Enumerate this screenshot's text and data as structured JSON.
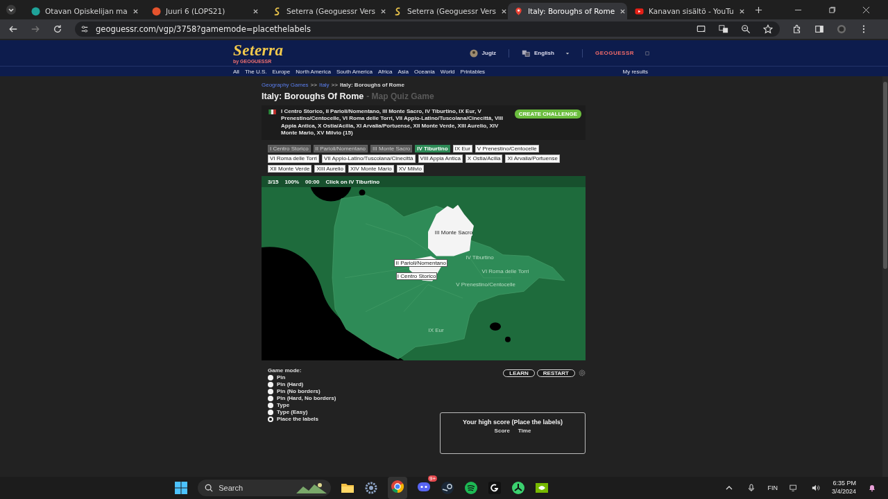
{
  "browser": {
    "tabs": [
      {
        "title": "Otavan Opiskelijan ma",
        "selected": false
      },
      {
        "title": "Juuri 6 (LOPS21)",
        "selected": false
      },
      {
        "title": "Seterra (Geoguessr Vers",
        "selected": false
      },
      {
        "title": "Seterra (Geoguessr Vers",
        "selected": false
      },
      {
        "title": "Italy: Boroughs of Rome",
        "selected": true
      },
      {
        "title": "Kanavan sisältö - YouTu",
        "selected": false
      }
    ],
    "address": "geoguessr.com/vgp/3758?gamemode=placethelabels"
  },
  "site": {
    "logo": "Seterra",
    "logo_byline": "by GEOGUESSR",
    "user": "Jugiz",
    "language": "English",
    "brand_link": "GEOGUESSR",
    "nav": [
      "All",
      "The U.S.",
      "Europe",
      "North America",
      "South America",
      "Africa",
      "Asia",
      "Oceania",
      "World",
      "Printables"
    ],
    "my_results": "My results"
  },
  "breadcrumb": {
    "links": [
      "Geography Games",
      "Italy"
    ],
    "separator": ">>",
    "current": "Italy: Boroughs of Rome"
  },
  "title": "Italy: Boroughs Of Rome",
  "subtitle": "- Map Quiz Game",
  "description": "I Centro Storico, II Parioli/Nomentano, III Monte Sacro, IV Tiburtino, IX Eur, V Prenestino/Centocelle, VI Roma delle Torri, VII Appio-Latino/Tuscolana/Cinecittà, VIII Appia Antica, X Ostia/Acilia, XI Arvalia/Portuense, XII Monte Verde, XIII Aurelio, XIV Monte Mario, XV Milvio (15)",
  "challenge_button": "CREATE CHALLENGE",
  "labels": [
    {
      "text": "I Centro Storico",
      "placed": true,
      "selected": false
    },
    {
      "text": "II Parioli/Nomentano",
      "placed": true,
      "selected": false
    },
    {
      "text": "III Monte Sacro",
      "placed": true,
      "selected": false
    },
    {
      "text": "IV Tiburtino",
      "placed": false,
      "selected": true
    },
    {
      "text": "IX Eur",
      "placed": false,
      "selected": false
    },
    {
      "text": "V Prenestino/Centocelle",
      "placed": false,
      "selected": false
    },
    {
      "text": "VI Roma delle Torri",
      "placed": false,
      "selected": false
    },
    {
      "text": "VII Appio-Latino/Tuscolana/Cinecittà",
      "placed": false,
      "selected": false
    },
    {
      "text": "VIII Appia Antica",
      "placed": false,
      "selected": false
    },
    {
      "text": "X Ostia/Acilia",
      "placed": false,
      "selected": false
    },
    {
      "text": "XI Arvalia/Portuense",
      "placed": false,
      "selected": false
    },
    {
      "text": "XII Monte Verde",
      "placed": false,
      "selected": false
    },
    {
      "text": "XIII Aurelio",
      "placed": false,
      "selected": false
    },
    {
      "text": "XIV Monte Mario",
      "placed": false,
      "selected": false
    },
    {
      "text": "XV Milvio",
      "placed": false,
      "selected": false
    }
  ],
  "map": {
    "counter": "3/15",
    "score": "100%",
    "timer": "00:00",
    "prompt": "Click on IV Tiburtino",
    "map_labels": [
      {
        "text": "III Monte Sacro",
        "kind": "on-region"
      },
      {
        "text": "IV Tiburtino",
        "kind": "faint"
      },
      {
        "text": "II Parioli/Nomentano",
        "kind": "boxed"
      },
      {
        "text": "VI Roma delle Torri",
        "kind": "faint"
      },
      {
        "text": "I Centro Storico",
        "kind": "boxed"
      },
      {
        "text": "V Prenestino/Centocelle",
        "kind": "faint"
      },
      {
        "text": "IX Eur",
        "kind": "faint"
      }
    ]
  },
  "controls": {
    "game_mode_label": "Game mode:",
    "modes": [
      {
        "label": "Pin",
        "selected": false
      },
      {
        "label": "Pin (Hard)",
        "selected": false
      },
      {
        "label": "Pin (No borders)",
        "selected": false
      },
      {
        "label": "Pin (Hard, No borders)",
        "selected": false
      },
      {
        "label": "Type",
        "selected": false
      },
      {
        "label": "Type (Easy)",
        "selected": false
      },
      {
        "label": "Place the labels",
        "selected": true
      }
    ],
    "buttons": [
      "LEARN",
      "RESTART"
    ]
  },
  "high_score": {
    "title": "Your high score (Place the labels)",
    "columns": [
      "Score",
      "Time"
    ]
  },
  "taskbar": {
    "search": "Search",
    "badge": "9+",
    "language": "FIN",
    "time": "6:35 PM",
    "date": "3/4/2024"
  }
}
